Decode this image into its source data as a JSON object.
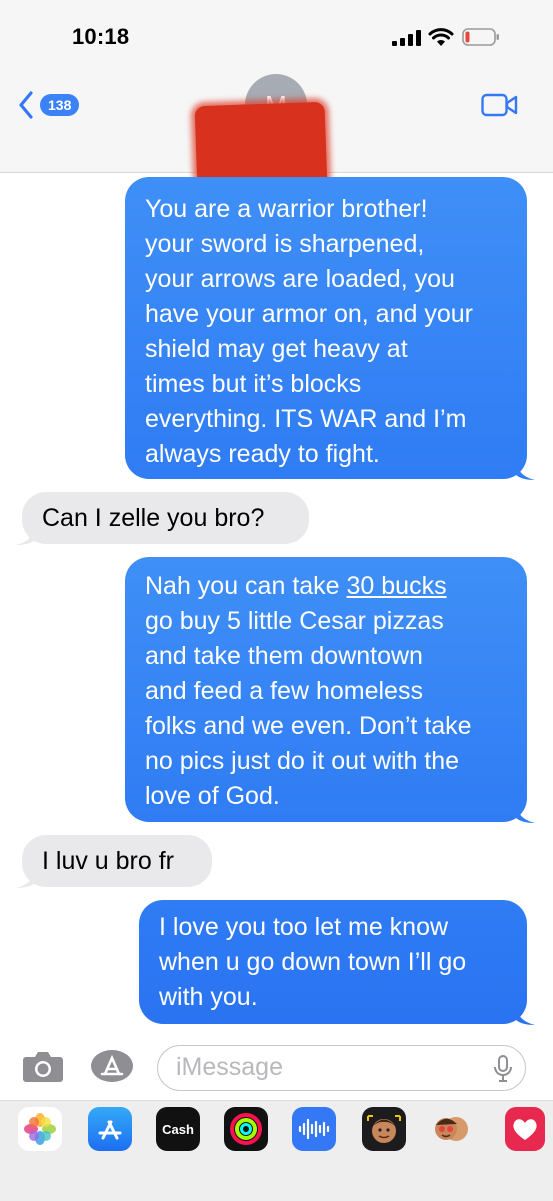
{
  "status_bar": {
    "time": "10:18"
  },
  "header": {
    "back_count": "138",
    "contact_initial": "M"
  },
  "messages": [
    {
      "side": "sent",
      "lines": [
        "You are a warrior brother!",
        "your sword is sharpened,",
        "your arrows are loaded, you",
        "have your armor on, and your",
        "shield may get heavy at",
        "times but it’s blocks",
        "everything. ITS WAR and I’m",
        "always ready to fight."
      ]
    },
    {
      "side": "received",
      "lines": [
        "Can I zelle you bro?"
      ]
    },
    {
      "side": "sent",
      "lines": [
        "go buy 5 little Cesar pizzas",
        "and take them downtown",
        "and feed a few homeless",
        "folks and we even. Don’t take",
        "no pics just do it out with the",
        "love of God."
      ],
      "first_line_prefix": "Nah you can take ",
      "first_line_link": "30 bucks"
    },
    {
      "side": "received",
      "lines": [
        "I luv u bro fr"
      ]
    },
    {
      "side": "sent",
      "lines": [
        "I love you too let me know",
        "when u go down town I’ll go",
        "with you."
      ]
    }
  ],
  "composer": {
    "placeholder": "iMessage"
  },
  "app_drawer": {
    "apps": [
      "photos-icon",
      "app-store-icon",
      "apple-cash-icon",
      "activity-icon",
      "audio-message-icon",
      "memoji-icon",
      "memoji-stickers-icon",
      "hearts-icon"
    ],
    "cash_label": "Cash"
  },
  "colors": {
    "sent_bubble": "#3485f6",
    "received_bubble": "#e9e9eb",
    "accent": "#3478f6"
  }
}
